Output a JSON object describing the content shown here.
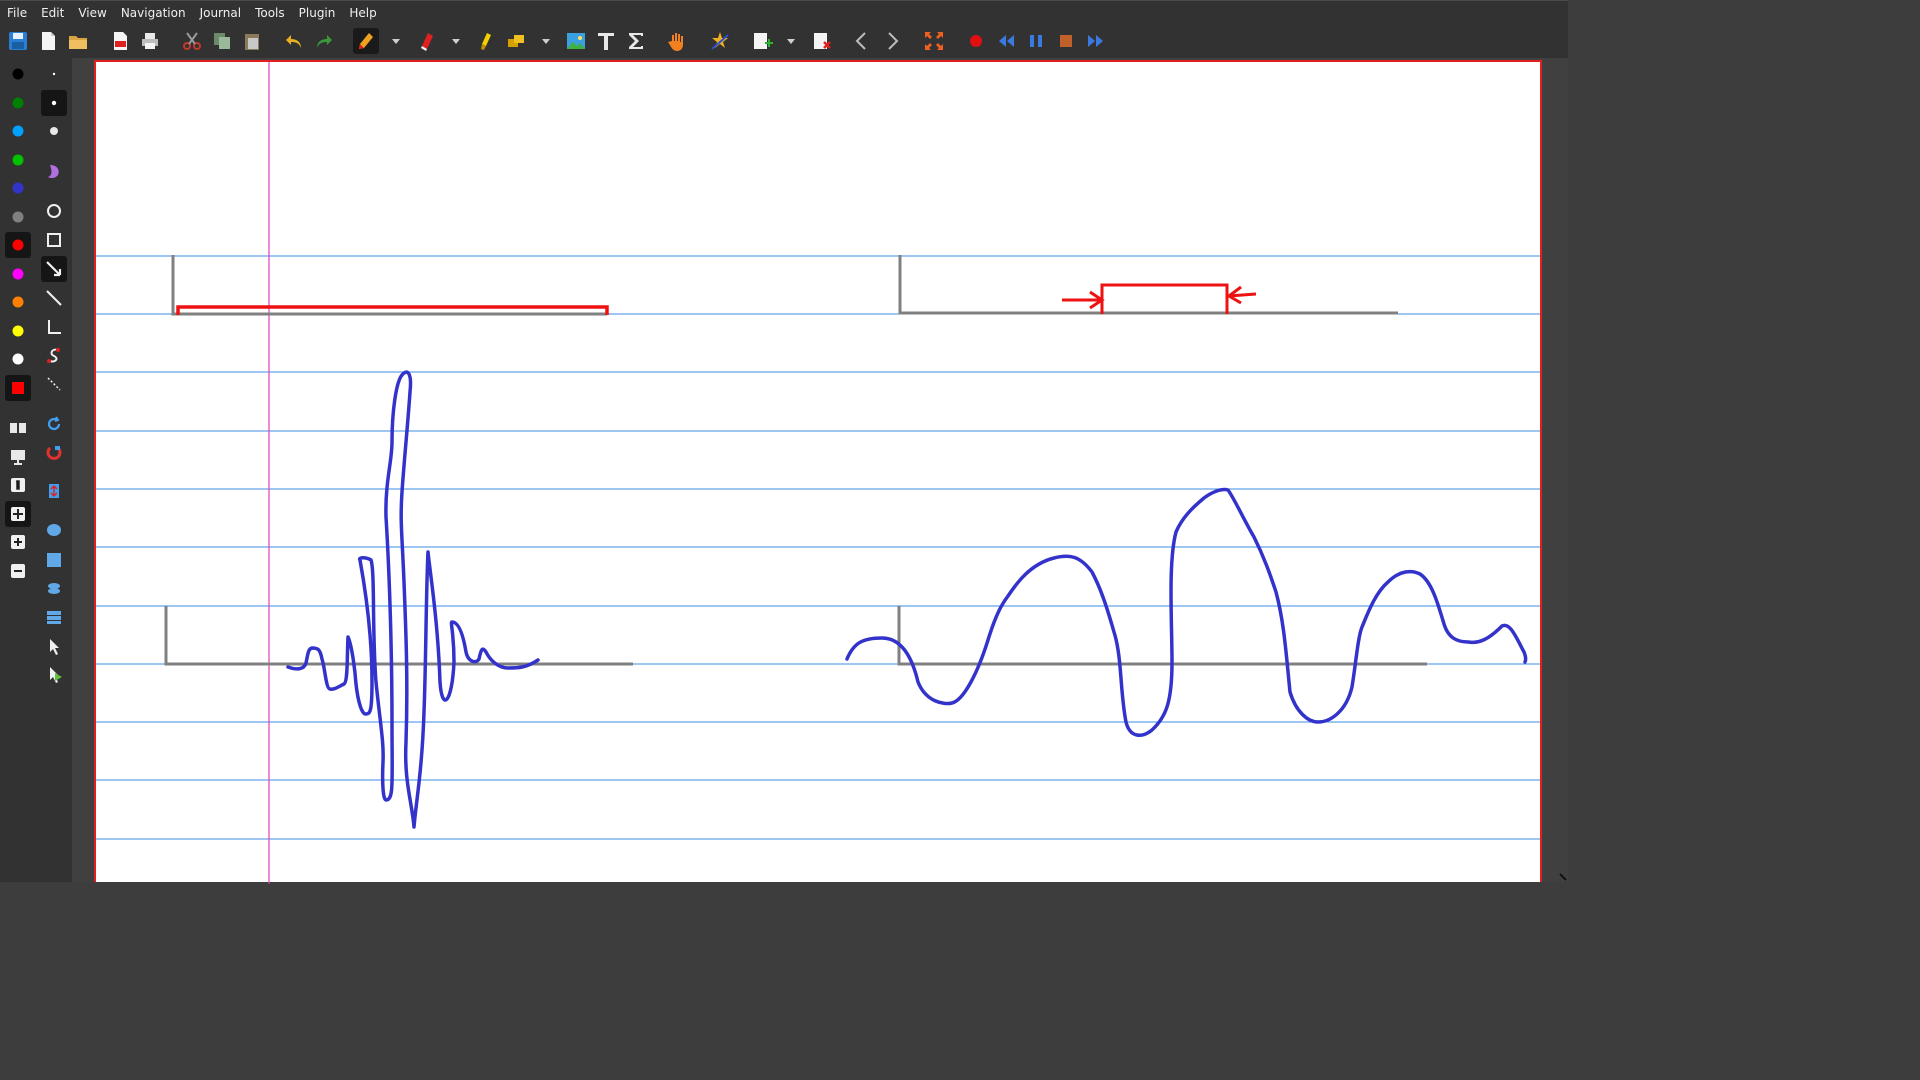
{
  "menu": {
    "items": [
      {
        "label": "File"
      },
      {
        "label": "Edit"
      },
      {
        "label": "View"
      },
      {
        "label": "Navigation"
      },
      {
        "label": "Journal"
      },
      {
        "label": "Tools"
      },
      {
        "label": "Plugin"
      },
      {
        "label": "Help"
      }
    ]
  },
  "toolbar": {
    "icons": [
      "save-icon",
      "new-document-icon",
      "open-folder-icon",
      "export-pdf-icon",
      "print-icon",
      "cut-icon",
      "copy-icon",
      "paste-icon",
      "undo-icon",
      "redo-icon",
      "pen-icon",
      "pen-dropdown",
      "eraser-icon",
      "eraser-dropdown",
      "highlighter-icon",
      "select-region-icon",
      "select-dropdown",
      "image-icon",
      "text-icon",
      "latex-sigma-icon",
      "hand-icon",
      "shape-recognizer-icon",
      "add-page-icon",
      "add-page-dropdown",
      "delete-page-icon",
      "previous-page-icon",
      "next-page-icon",
      "fullscreen-icon",
      "record-icon",
      "rewind-icon",
      "pause-icon",
      "stop-icon",
      "fast-forward-icon"
    ]
  },
  "palette": {
    "colors": [
      "#000000",
      "#008000",
      "#00a0ff",
      "#00c000",
      "#3333cc",
      "#808080",
      "#ff0000",
      "#ff00ff",
      "#ff8000",
      "#ffff00",
      "#ffffff",
      "#ff0000"
    ],
    "selected_color": "#ff0000"
  },
  "page": {
    "background": "#ffffff",
    "rule_color": "#3c8ee6",
    "margin_color": "#e040c0",
    "ink_colors": {
      "red": "#ee1111",
      "blue": "#3333cc",
      "gray": "#808080"
    }
  }
}
